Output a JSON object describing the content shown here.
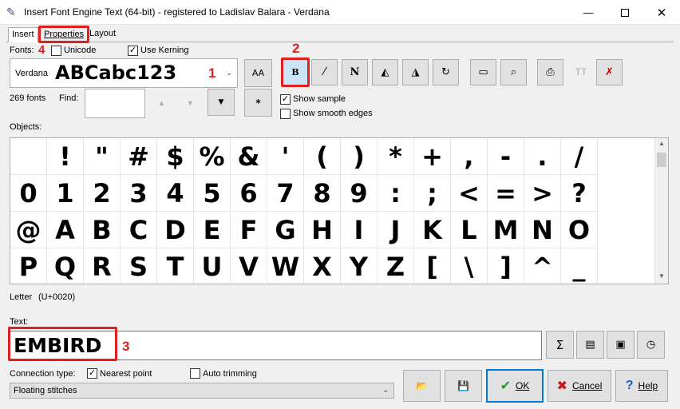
{
  "window": {
    "title": "Insert Font Engine Text (64-bit) - registered to Ladislav Balara - Verdana"
  },
  "tabs": [
    {
      "label": "Insert"
    },
    {
      "label": "Properties"
    },
    {
      "label": "Layout"
    }
  ],
  "fonts": {
    "label": "Fonts:",
    "unicode_label": "Unicode",
    "kerning_label": "Use Kerning",
    "selected_font": "Verdana",
    "sample": "ABCabc123",
    "count": "269 fonts",
    "find_label": "Find:",
    "find_value": ""
  },
  "annotations": {
    "n1": "1",
    "n2": "2",
    "n3": "3",
    "n4": "4"
  },
  "toolbar": {
    "aa_label": "AA",
    "star_label": "*",
    "bold_label": "B",
    "show_sample": "Show sample",
    "show_smooth": "Show smooth edges"
  },
  "objects": {
    "label": "Objects:",
    "rows": [
      [
        " ",
        "!",
        "\"",
        "#",
        "$",
        "%",
        "&",
        "'",
        "(",
        ")",
        "*",
        "+",
        ",",
        "-",
        ".",
        "/"
      ],
      [
        "0",
        "1",
        "2",
        "3",
        "4",
        "5",
        "6",
        "7",
        "8",
        "9",
        ":",
        ";",
        "<",
        "=",
        ">",
        "?"
      ],
      [
        "@",
        "A",
        "B",
        "C",
        "D",
        "E",
        "F",
        "G",
        "H",
        "I",
        "J",
        "K",
        "L",
        "M",
        "N",
        "O"
      ],
      [
        "P",
        "Q",
        "R",
        "S",
        "T",
        "U",
        "V",
        "W",
        "X",
        "Y",
        "Z",
        "[",
        "\\",
        "]",
        "^",
        "_"
      ]
    ],
    "letter_label": "Letter",
    "letter_code": "(U+0020)"
  },
  "text": {
    "label": "Text:",
    "value": "EMBIRD",
    "sigma": "Σ"
  },
  "connection": {
    "label": "Connection type:",
    "nearest_label": "Nearest point",
    "auto_label": "Auto trimming",
    "selected": "Floating stitches"
  },
  "buttons": {
    "ok": "OK",
    "cancel": "Cancel",
    "help": "Help"
  },
  "colors": {
    "annotation_red": "#e0201f",
    "ok_border": "#0078d7"
  }
}
